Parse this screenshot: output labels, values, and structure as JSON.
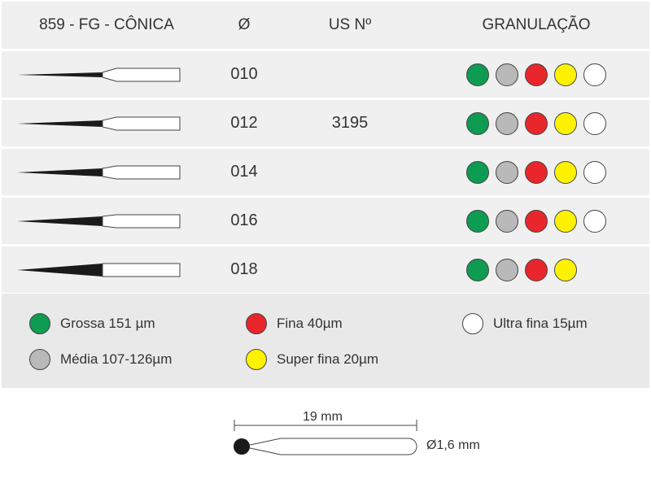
{
  "header": {
    "model": "859 - FG - CÔNICA",
    "diameter": "Ø",
    "us_no": "US Nº",
    "granulation": "GRANULAÇÃO"
  },
  "rows": [
    {
      "size": "010",
      "us": "",
      "grits": [
        "green",
        "gray",
        "red",
        "yellow",
        "white"
      ]
    },
    {
      "size": "012",
      "us": "3195",
      "grits": [
        "green",
        "gray",
        "red",
        "yellow",
        "white"
      ]
    },
    {
      "size": "014",
      "us": "",
      "grits": [
        "green",
        "gray",
        "red",
        "yellow",
        "white"
      ]
    },
    {
      "size": "016",
      "us": "",
      "grits": [
        "green",
        "gray",
        "red",
        "yellow",
        "white"
      ]
    },
    {
      "size": "018",
      "us": "",
      "grits": [
        "green",
        "gray",
        "red",
        "yellow"
      ]
    }
  ],
  "legend": {
    "grossa": "Grossa 151 µm",
    "media": "Média 107-126µm",
    "fina": "Fina 40µm",
    "super_fina": "Super fina 20µm",
    "ultra_fina": "Ultra fina 15µm"
  },
  "colors": {
    "green": "#0e9b52",
    "gray": "#b9b9b9",
    "red": "#e8262c",
    "yellow": "#fff200",
    "white": "#ffffff"
  },
  "diagram": {
    "length": "19 mm",
    "shank_diameter": "Ø1,6 mm"
  }
}
